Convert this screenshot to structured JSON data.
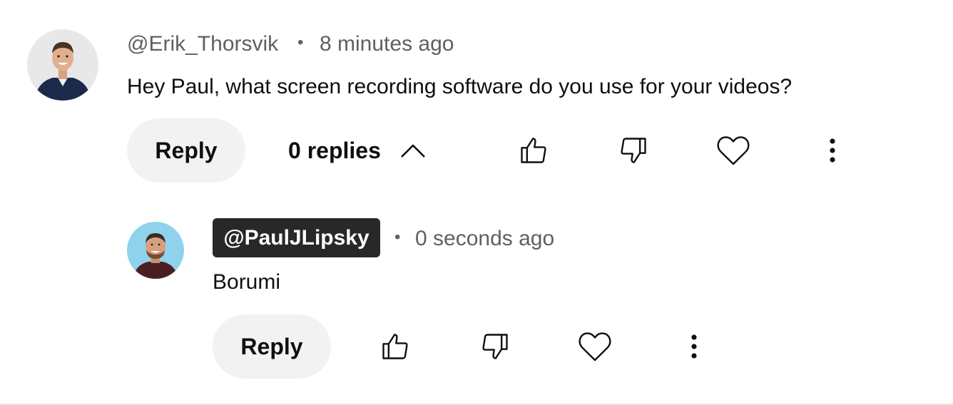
{
  "comment": {
    "author": "@Erik_Thorsvik",
    "dot": "•",
    "time": "8 minutes ago",
    "text": "Hey Paul, what screen recording software do you use for your videos?",
    "reply_label": "Reply",
    "replies_label": "0 replies",
    "icons": [
      "avatar",
      "like-icon",
      "dislike-icon",
      "heart-icon",
      "more-options-icon",
      "chevron-up-icon"
    ]
  },
  "reply": {
    "author": "@PaulJLipsky",
    "dot": "•",
    "time": "0 seconds ago",
    "text": "Borumi",
    "reply_label": "Reply",
    "icons": [
      "avatar",
      "like-icon",
      "dislike-icon",
      "heart-icon",
      "more-options-icon"
    ]
  }
}
